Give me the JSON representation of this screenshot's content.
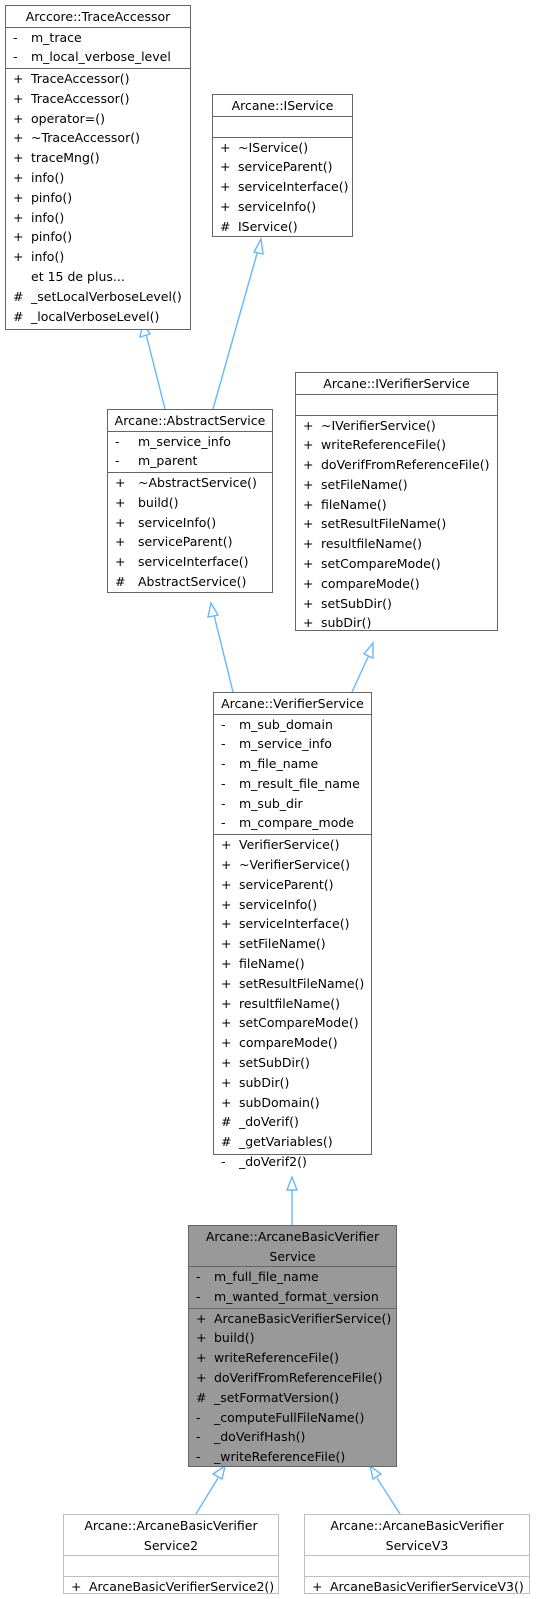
{
  "diagram": {
    "type": "uml-class-inheritance",
    "classes": {
      "trace_accessor": {
        "name": "Arccore::TraceAccessor",
        "attributes": [
          {
            "vis": "-",
            "name": "m_trace"
          },
          {
            "vis": "-",
            "name": "m_local_verbose_level"
          }
        ],
        "methods": [
          {
            "vis": "+",
            "name": "TraceAccessor()"
          },
          {
            "vis": "+",
            "name": "TraceAccessor()"
          },
          {
            "vis": "+",
            "name": "operator=()"
          },
          {
            "vis": "+",
            "name": "~TraceAccessor()"
          },
          {
            "vis": "+",
            "name": "traceMng()"
          },
          {
            "vis": "+",
            "name": "info()"
          },
          {
            "vis": "+",
            "name": "pinfo()"
          },
          {
            "vis": "+",
            "name": "info()"
          },
          {
            "vis": "+",
            "name": "pinfo()"
          },
          {
            "vis": "+",
            "name": "info()"
          },
          {
            "vis": "",
            "name": "et 15 de plus..."
          },
          {
            "vis": "#",
            "name": "_setLocalVerboseLevel()"
          },
          {
            "vis": "#",
            "name": "_localVerboseLevel()"
          }
        ]
      },
      "iservice": {
        "name": "Arcane::IService",
        "attributes": [],
        "methods": [
          {
            "vis": "+",
            "name": "~IService()"
          },
          {
            "vis": "+",
            "name": "serviceParent()"
          },
          {
            "vis": "+",
            "name": "serviceInterface()"
          },
          {
            "vis": "+",
            "name": "serviceInfo()"
          },
          {
            "vis": "#",
            "name": "IService()"
          }
        ]
      },
      "abstract_service": {
        "name": "Arcane::AbstractService",
        "attributes": [
          {
            "vis": "-",
            "name": "m_service_info"
          },
          {
            "vis": "-",
            "name": "m_parent"
          }
        ],
        "methods": [
          {
            "vis": "+",
            "name": "~AbstractService()"
          },
          {
            "vis": "+",
            "name": "build()"
          },
          {
            "vis": "+",
            "name": "serviceInfo()"
          },
          {
            "vis": "+",
            "name": "serviceParent()"
          },
          {
            "vis": "+",
            "name": "serviceInterface()"
          },
          {
            "vis": "#",
            "name": "AbstractService()"
          }
        ]
      },
      "iverifier_service": {
        "name": "Arcane::IVerifierService",
        "attributes": [],
        "methods": [
          {
            "vis": "+",
            "name": "~IVerifierService()"
          },
          {
            "vis": "+",
            "name": "writeReferenceFile()"
          },
          {
            "vis": "+",
            "name": "doVerifFromReferenceFile()"
          },
          {
            "vis": "+",
            "name": "setFileName()"
          },
          {
            "vis": "+",
            "name": "fileName()"
          },
          {
            "vis": "+",
            "name": "setResultFileName()"
          },
          {
            "vis": "+",
            "name": "resultfileName()"
          },
          {
            "vis": "+",
            "name": "setCompareMode()"
          },
          {
            "vis": "+",
            "name": "compareMode()"
          },
          {
            "vis": "+",
            "name": "setSubDir()"
          },
          {
            "vis": "+",
            "name": "subDir()"
          }
        ]
      },
      "verifier_service": {
        "name": "Arcane::VerifierService",
        "attributes": [
          {
            "vis": "-",
            "name": "m_sub_domain"
          },
          {
            "vis": "-",
            "name": "m_service_info"
          },
          {
            "vis": "-",
            "name": "m_file_name"
          },
          {
            "vis": "-",
            "name": "m_result_file_name"
          },
          {
            "vis": "-",
            "name": "m_sub_dir"
          },
          {
            "vis": "-",
            "name": "m_compare_mode"
          }
        ],
        "methods": [
          {
            "vis": "+",
            "name": "VerifierService()"
          },
          {
            "vis": "+",
            "name": "~VerifierService()"
          },
          {
            "vis": "+",
            "name": "serviceParent()"
          },
          {
            "vis": "+",
            "name": "serviceInfo()"
          },
          {
            "vis": "+",
            "name": "serviceInterface()"
          },
          {
            "vis": "+",
            "name": "setFileName()"
          },
          {
            "vis": "+",
            "name": "fileName()"
          },
          {
            "vis": "+",
            "name": "setResultFileName()"
          },
          {
            "vis": "+",
            "name": "resultfileName()"
          },
          {
            "vis": "+",
            "name": "setCompareMode()"
          },
          {
            "vis": "+",
            "name": "compareMode()"
          },
          {
            "vis": "+",
            "name": "setSubDir()"
          },
          {
            "vis": "+",
            "name": "subDir()"
          },
          {
            "vis": "+",
            "name": "subDomain()"
          },
          {
            "vis": "#",
            "name": "_doVerif()"
          },
          {
            "vis": "#",
            "name": "_getVariables()"
          },
          {
            "vis": "-",
            "name": "_doVerif2()"
          }
        ]
      },
      "basic_verifier_service": {
        "name_line1": "Arcane::ArcaneBasicVerifier",
        "name_line2": "Service",
        "attributes": [
          {
            "vis": "-",
            "name": "m_full_file_name"
          },
          {
            "vis": "-",
            "name": "m_wanted_format_version"
          }
        ],
        "methods": [
          {
            "vis": "+",
            "name": "ArcaneBasicVerifierService()"
          },
          {
            "vis": "+",
            "name": "build()"
          },
          {
            "vis": "+",
            "name": "writeReferenceFile()"
          },
          {
            "vis": "+",
            "name": "doVerifFromReferenceFile()"
          },
          {
            "vis": "#",
            "name": "_setFormatVersion()"
          },
          {
            "vis": "-",
            "name": "_computeFullFileName()"
          },
          {
            "vis": "-",
            "name": "_doVerifHash()"
          },
          {
            "vis": "-",
            "name": "_writeReferenceFile()"
          }
        ]
      },
      "basic_verifier_service2": {
        "name_line1": "Arcane::ArcaneBasicVerifier",
        "name_line2": "Service2",
        "attributes": [],
        "methods": [
          {
            "vis": "+",
            "name": "ArcaneBasicVerifierService2()"
          }
        ]
      },
      "basic_verifier_service_v3": {
        "name_line1": "Arcane::ArcaneBasicVerifier",
        "name_line2": "ServiceV3",
        "attributes": [],
        "methods": [
          {
            "vis": "+",
            "name": "ArcaneBasicVerifierServiceV3()"
          }
        ]
      }
    },
    "inheritance": [
      {
        "child": "Arcane::AbstractService",
        "parent": "Arccore::TraceAccessor"
      },
      {
        "child": "Arcane::AbstractService",
        "parent": "Arcane::IService"
      },
      {
        "child": "Arcane::VerifierService",
        "parent": "Arcane::AbstractService"
      },
      {
        "child": "Arcane::VerifierService",
        "parent": "Arcane::IVerifierService"
      },
      {
        "child": "Arcane::ArcaneBasicVerifierService",
        "parent": "Arcane::VerifierService"
      },
      {
        "child": "Arcane::ArcaneBasicVerifierService2",
        "parent": "Arcane::ArcaneBasicVerifierService"
      },
      {
        "child": "Arcane::ArcaneBasicVerifierServiceV3",
        "parent": "Arcane::ArcaneBasicVerifierService"
      }
    ],
    "colors": {
      "edge": "#63b8ff",
      "border": "#666666",
      "light_border": "#bfbfbf",
      "focus_fill": "#999999"
    }
  }
}
